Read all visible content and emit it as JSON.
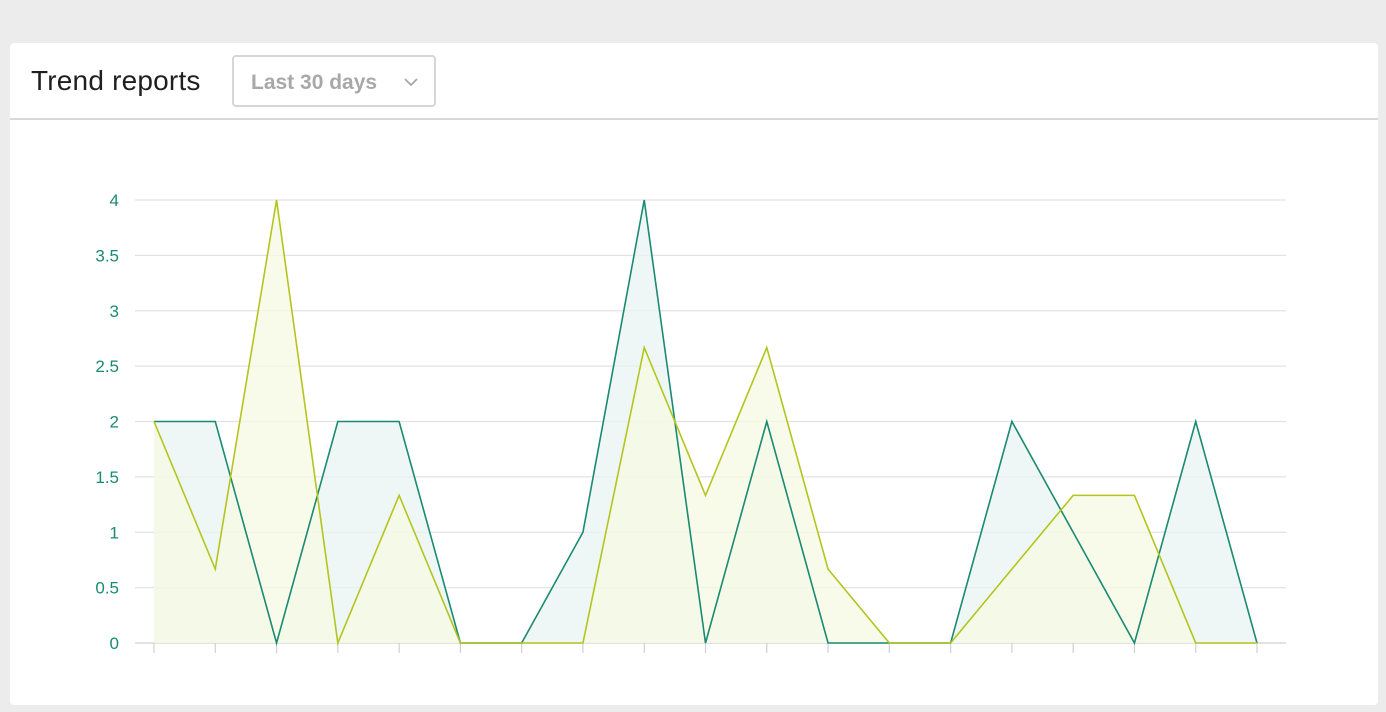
{
  "header": {
    "title": "Trend reports",
    "range_select": {
      "value": "Last 30 days",
      "icon": "chevron-down-icon"
    }
  },
  "colors": {
    "teal": "#1a8a72",
    "lime": "#b3c51e",
    "grid": "#e3e3e3",
    "axis_label": "#1a8a72"
  },
  "chart_data": {
    "type": "area",
    "ylim": [
      0,
      4
    ],
    "yticks": [
      "0",
      "0.5",
      "1",
      "1.5",
      "2",
      "2.5",
      "3",
      "3.5",
      "4"
    ],
    "x": [
      0,
      1,
      2,
      3,
      4,
      5,
      6,
      7,
      8,
      9,
      10,
      11,
      12,
      13,
      14,
      15,
      16,
      17,
      18
    ],
    "grid": true,
    "series": [
      {
        "color": "#1a8a72",
        "fill": "#e9f3f3",
        "values": [
          2,
          2,
          0,
          2,
          2,
          0,
          0,
          1,
          4,
          0,
          2,
          0,
          0,
          0,
          2,
          1,
          0,
          2,
          0
        ]
      },
      {
        "color": "#b3c51e",
        "fill": "#f6f9e3",
        "values": [
          2,
          0.667,
          4,
          0,
          1.333,
          0,
          0,
          0,
          2.667,
          1.333,
          2.667,
          0.667,
          0,
          0,
          0.667,
          1.333,
          1.333,
          0,
          0
        ]
      }
    ]
  }
}
